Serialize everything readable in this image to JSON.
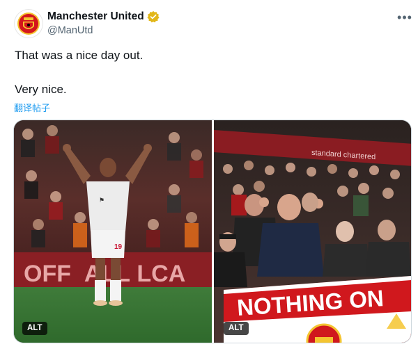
{
  "author": {
    "display_name": "Manchester United",
    "handle": "@ManUtd",
    "avatar_icon": "manchester-united-crest-icon",
    "verified_icon": "verified-gold-badge-icon"
  },
  "more_icon_glyph": "•••",
  "post": {
    "line1": "That was a nice day out.",
    "line2": "Very nice.",
    "translate_label": "翻译帖子"
  },
  "media": {
    "left_photo": {
      "alt_label": "ALT",
      "board_text": "OFF  ALL LCA",
      "shirt_number": "19"
    },
    "right_photo": {
      "alt_label": "ALT",
      "banner_text": "NOTHING ON",
      "sponsor_text": "standard chartered"
    }
  },
  "colors": {
    "link_blue": "#1d9bf0",
    "verified_gold": "#e2b719",
    "banner_red": "#d0181d",
    "secondary_text": "#536471"
  }
}
